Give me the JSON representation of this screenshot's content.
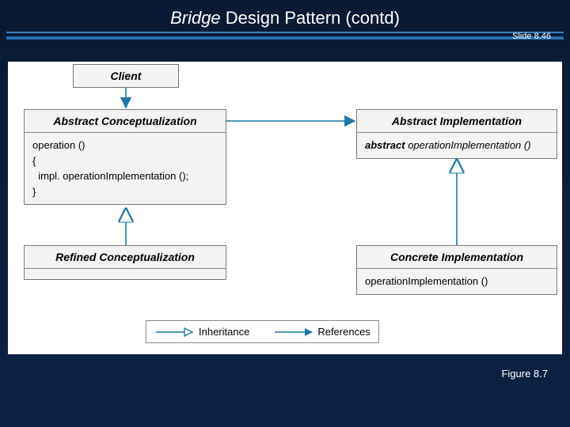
{
  "slide": {
    "title_italic": "Bridge",
    "title_rest": " Design Pattern (contd)",
    "slide_number": "Slide 8.46",
    "figure_label": "Figure 8.7"
  },
  "colors": {
    "arrow": "#1f78a8"
  },
  "boxes": {
    "client": {
      "header": "Client"
    },
    "abs_concept": {
      "header": "Abstract Conceptualization",
      "body_l1": "operation ()",
      "body_l2": "{",
      "body_l3": "  impl. operationImplementation ();",
      "body_l4": "}"
    },
    "abs_impl": {
      "header": "Abstract Implementation",
      "body_kw": "abstract",
      "body_rest": " operationImplementation ()"
    },
    "ref_concept": {
      "header": "Refined Conceptualization"
    },
    "conc_impl": {
      "header": "Concrete Implementation",
      "body": "operationImplementation ()"
    }
  },
  "legend": {
    "inheritance": "Inheritance",
    "references": "References"
  },
  "chart_data": {
    "type": "diagram",
    "title": "Bridge Design Pattern UML class diagram",
    "nodes": [
      {
        "id": "client",
        "label": "Client"
      },
      {
        "id": "abs_concept",
        "label": "Abstract Conceptualization",
        "members": [
          "operation () { impl.operationImplementation(); }"
        ]
      },
      {
        "id": "abs_impl",
        "label": "Abstract Implementation",
        "members": [
          "abstract operationImplementation ()"
        ]
      },
      {
        "id": "ref_concept",
        "label": "Refined Conceptualization"
      },
      {
        "id": "conc_impl",
        "label": "Concrete Implementation",
        "members": [
          "operationImplementation ()"
        ]
      }
    ],
    "edges": [
      {
        "from": "client",
        "to": "abs_concept",
        "kind": "references"
      },
      {
        "from": "abs_concept",
        "to": "abs_impl",
        "kind": "references"
      },
      {
        "from": "ref_concept",
        "to": "abs_concept",
        "kind": "inheritance"
      },
      {
        "from": "conc_impl",
        "to": "abs_impl",
        "kind": "inheritance"
      }
    ],
    "legend": [
      "Inheritance (open triangle arrow)",
      "References (filled arrow)"
    ]
  }
}
